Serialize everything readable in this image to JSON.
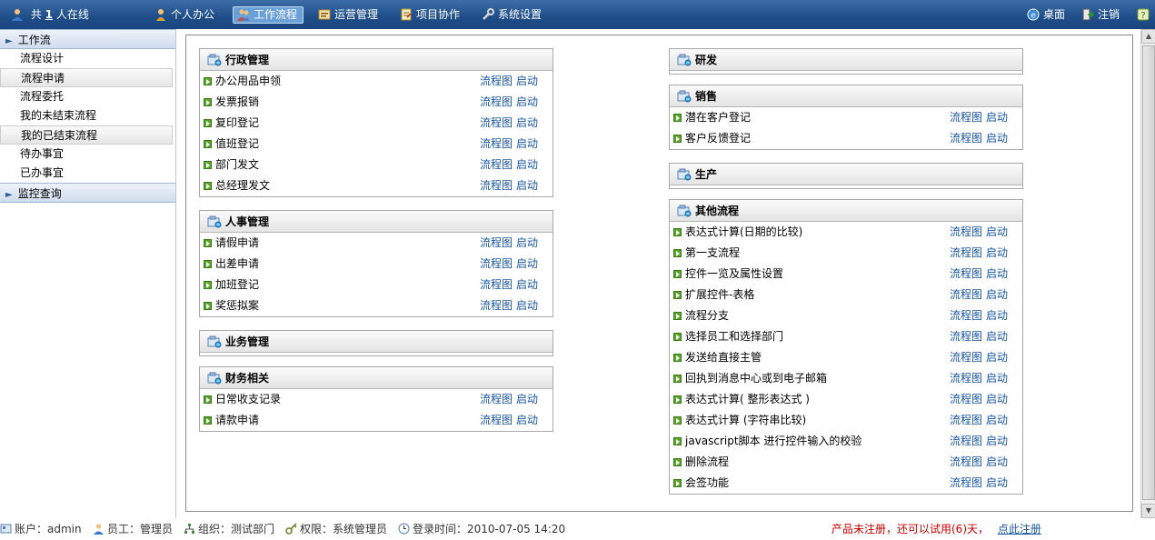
{
  "topbar": {
    "online_prefix": "共",
    "online_count": "1",
    "online_suffix": "人在线",
    "nav": [
      {
        "label": "个人办公",
        "icon": "person-icon"
      },
      {
        "label": "工作流程",
        "icon": "workflow-icon",
        "active": true
      },
      {
        "label": "运营管理",
        "icon": "operations-icon"
      },
      {
        "label": "项目协作",
        "icon": "project-icon"
      },
      {
        "label": "系统设置",
        "icon": "wrench-icon"
      }
    ],
    "desktop_label": "桌面",
    "logout_label": "注销",
    "help_icon": "help-icon"
  },
  "sidebar": {
    "workflow_section": "工作流",
    "items": [
      {
        "label": "流程设计"
      },
      {
        "label": "流程申请",
        "highlight": true
      },
      {
        "label": "流程委托"
      },
      {
        "label": "我的未结束流程"
      },
      {
        "label": "我的已结束流程",
        "highlight": true
      },
      {
        "label": "待办事宜"
      },
      {
        "label": "已办事宜"
      }
    ],
    "monitor_section": "监控查询"
  },
  "actions": {
    "diagram": "流程图",
    "start": "启动"
  },
  "panels": {
    "admin": {
      "title": "行政管理",
      "items": [
        "办公用品申领",
        "发票报销",
        "复印登记",
        "值班登记",
        "部门发文",
        "总经理发文"
      ]
    },
    "hr": {
      "title": "人事管理",
      "items": [
        "请假申请",
        "出差申请",
        "加班登记",
        "奖惩拟案"
      ]
    },
    "business": {
      "title": "业务管理",
      "items": []
    },
    "finance": {
      "title": "财务相关",
      "items": [
        "日常收支记录",
        "请款申请"
      ]
    },
    "rnd": {
      "title": "研发",
      "items": []
    },
    "sales": {
      "title": "销售",
      "items": [
        "潜在客户登记",
        "客户反馈登记"
      ]
    },
    "production": {
      "title": "生产",
      "items": []
    },
    "other": {
      "title": "其他流程",
      "items": [
        "表达式计算(日期的比较)",
        "第一支流程",
        "控件一览及属性设置",
        "扩展控件-表格",
        "流程分支",
        "选择员工和选择部门",
        "发送给直接主管",
        "回执到消息中心或到电子邮箱",
        "表达式计算( 整形表达式 )",
        "表达式计算 (字符串比较)",
        "javascript脚本 进行控件输入的校验",
        "删除流程",
        "会签功能"
      ]
    }
  },
  "status": {
    "account_label": "账户：admin",
    "employee_label": "员工：管理员",
    "org_label": "组织：测试部门",
    "perm_label": "权限：系统管理员",
    "login_time_label": "登录时间：2010-07-05 14:20",
    "trial_notice": "产品未注册，还可以试用(6)天，",
    "register_link": "点此注册"
  },
  "colors": {
    "topbar": "#1e4d88",
    "link": "#1a57a0",
    "warning": "#cc0000",
    "bullet": "#5aa42b"
  }
}
